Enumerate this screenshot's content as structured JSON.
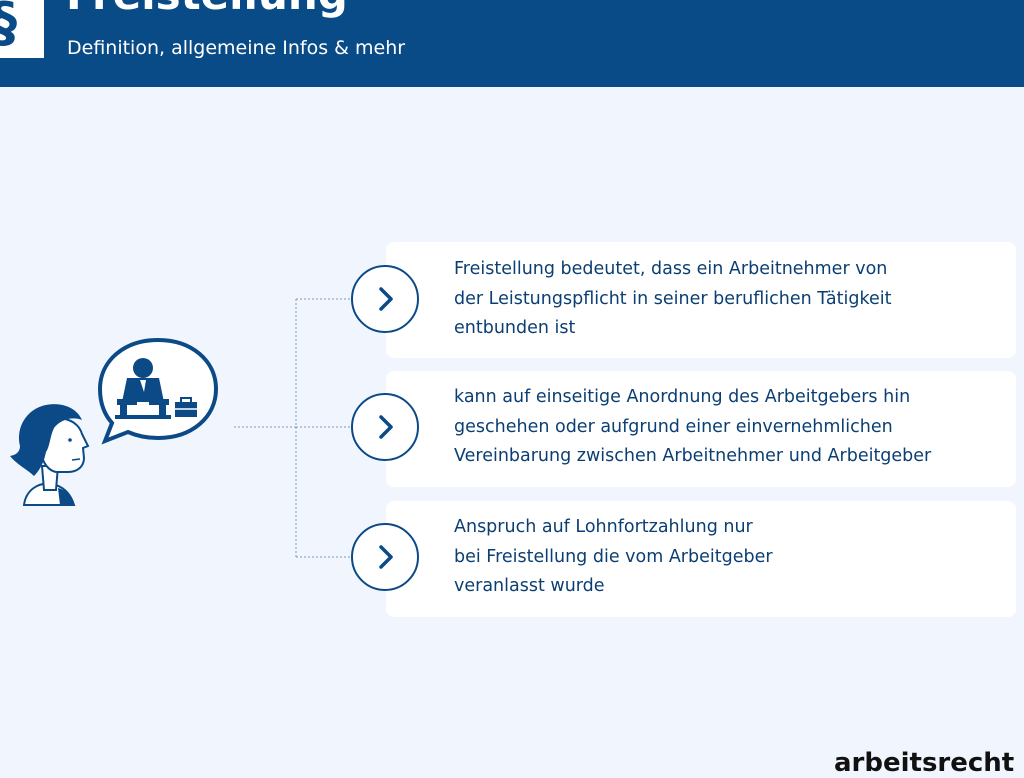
{
  "header": {
    "logo_symbol": "§",
    "title": "Freistellung",
    "subtitle": "Definition, allgemeine Infos & mehr",
    "background_color": "#094b87"
  },
  "illustration": {
    "icons": [
      "person-head-icon",
      "speech-bubble-icon",
      "sitting-worker-icon",
      "briefcase-icon"
    ]
  },
  "items": [
    {
      "icon": "chevron-right-icon",
      "lines": [
        "Freistellung bedeutet, dass ein Arbeitnehmer von",
        "der Leistungspflicht in seiner beruflichen Tätigkeit",
        "entbunden ist"
      ]
    },
    {
      "icon": "chevron-right-icon",
      "lines": [
        "kann auf einseitige Anordnung des Arbeitgebers hin",
        "geschehen oder aufgrund einer einvernehmlichen",
        "Vereinbarung zwischen Arbeitnehmer und Arbeitgeber"
      ]
    },
    {
      "icon": "chevron-right-icon",
      "lines": [
        "Anspruch auf Lohnfortzahlung nur",
        "bei Freistellung die vom Arbeitgeber",
        "veranlasst wurde"
      ]
    }
  ],
  "footer": {
    "brand": "arbeitsrecht"
  },
  "colors": {
    "accent": "#0b4a86",
    "background": "#f1f5fd",
    "card": "#ffffff",
    "text": "#0b3f73"
  }
}
